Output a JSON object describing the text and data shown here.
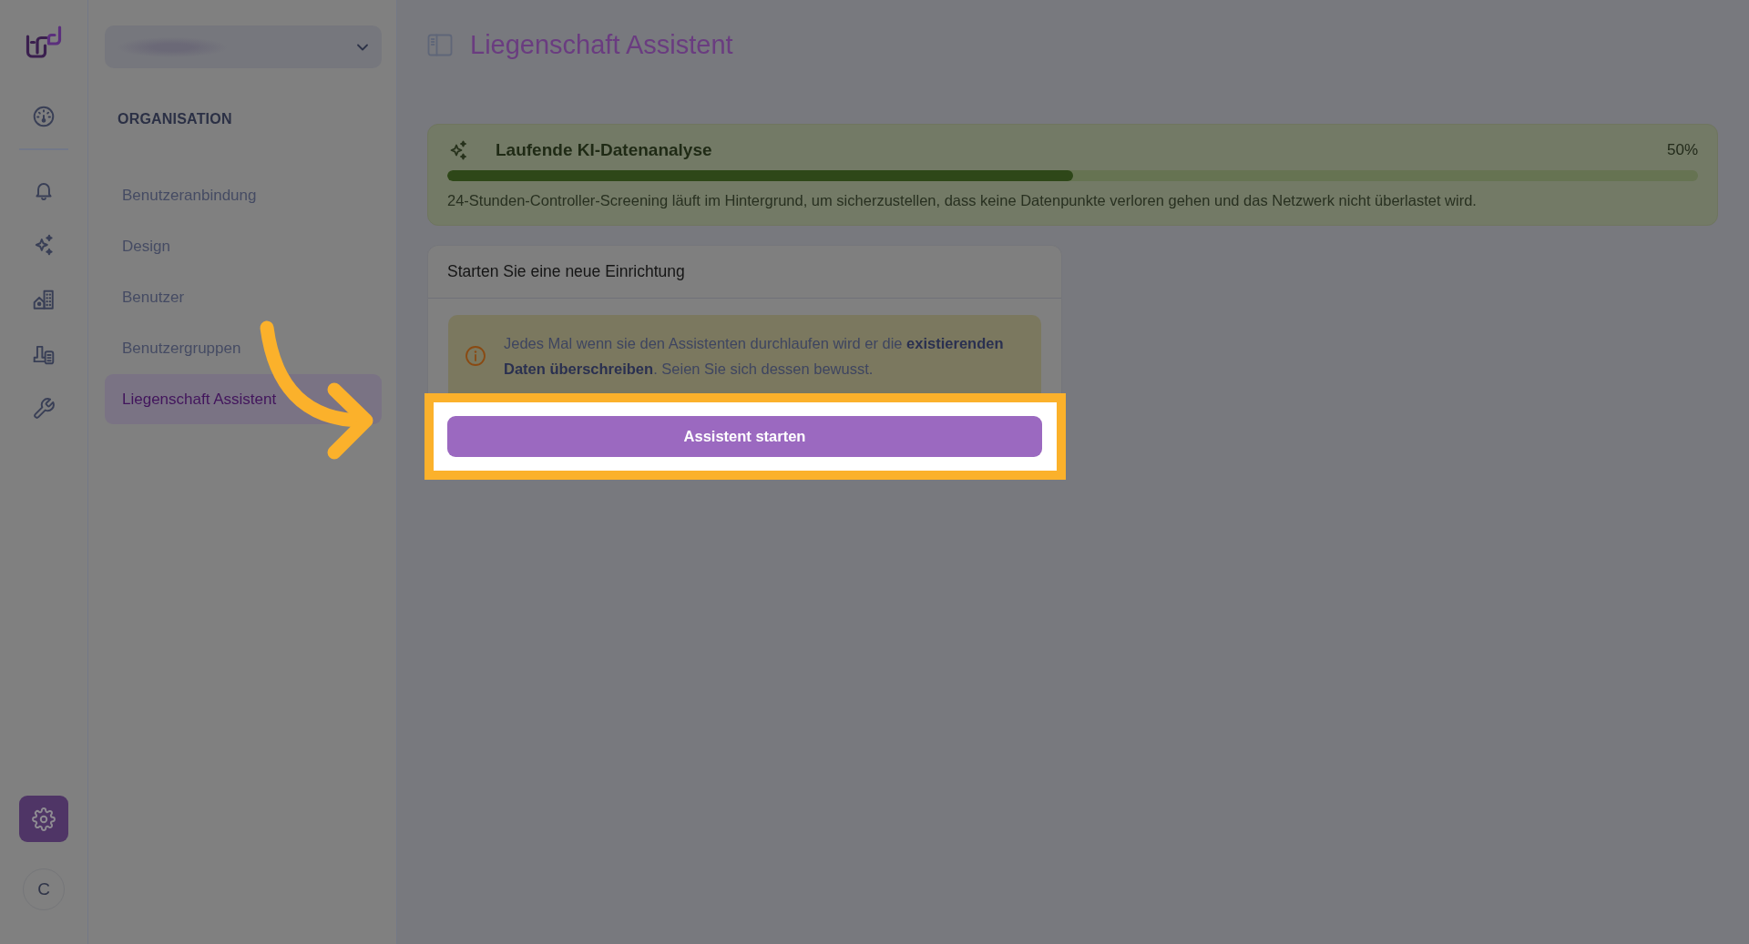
{
  "nav_rail": {
    "items": [
      {
        "selected": false
      },
      {
        "selected": false
      },
      {
        "selected": false
      },
      {
        "selected": false
      },
      {
        "selected": false
      },
      {
        "selected": false
      }
    ],
    "settings": {
      "selected": true
    },
    "avatar": {
      "initial": "C"
    }
  },
  "sidebar": {
    "organization_select": {
      "expanded": false
    },
    "section_title": "ORGANISATION",
    "items": [
      {
        "label": "Benutzeranbindung",
        "selected": false
      },
      {
        "label": "Design",
        "selected": false
      },
      {
        "label": "Benutzer",
        "selected": false
      },
      {
        "label": "Benutzergruppen",
        "selected": false
      },
      {
        "label": "Liegenschaft Assistent",
        "selected": true
      }
    ]
  },
  "header": {
    "title": "Liegenschaft Assistent"
  },
  "analysis_card": {
    "title": "Laufende KI-Datenanalyse",
    "percent": "50%",
    "level": 0.5,
    "description": "24-Stunden-Controller-Screening läuft im Hintergrund, um sicherzustellen, dass keine Datenpunkte verloren gehen und das Netzwerk nicht überlastet wird."
  },
  "setup_card": {
    "title": "Starten Sie eine neue Einrichtung",
    "warning": "Jedes Mal wenn sie den Assistenten durchlaufen wird er die **existierenden Daten überschreiben**. Seien Sie sich dessen bewusst.",
    "button": {
      "label": "Assistent starten",
      "highlighted": true
    }
  }
}
